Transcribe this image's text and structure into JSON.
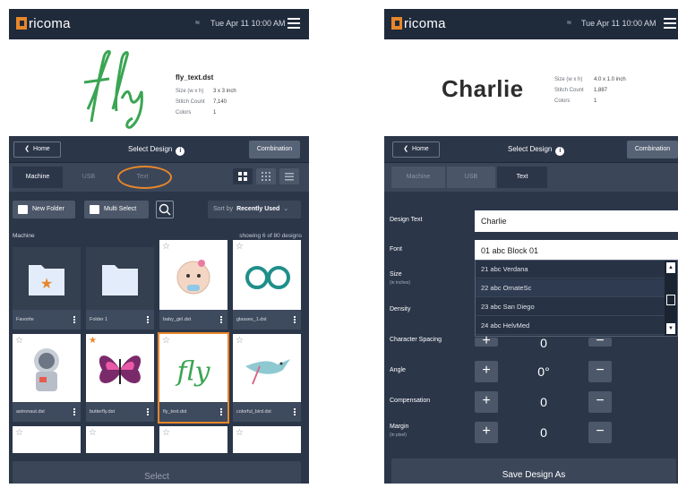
{
  "status": {
    "brand": "ricoma",
    "time": "Tue Apr 11  10:00 AM"
  },
  "left": {
    "design": {
      "art_text": "fly",
      "file": "fly_text.dst",
      "size_label": "Size (w x h)",
      "size_value": "3 x 3 inch",
      "stitch_label": "Stitch Count",
      "stitch_value": "7,140",
      "colors_label": "Colors",
      "colors_value": "1"
    },
    "nav": {
      "home": "Home",
      "title": "Select Design",
      "combination": "Combination"
    },
    "tabs": [
      "Machine",
      "USB",
      "Text"
    ],
    "actions": {
      "new_folder": "New Folder",
      "multi_select": "Multi Select",
      "sort_prefix": "Sort by",
      "sort_value": "Recently Used"
    },
    "location": "Machine",
    "showing": "showing 6 of 80 designs",
    "tiles": [
      {
        "name": "Favorite"
      },
      {
        "name": "Folder 1"
      },
      {
        "name": "baby_girl.dst"
      },
      {
        "name": "glasses_1.dst"
      },
      {
        "name": "astronaut.dst"
      },
      {
        "name": "butterfly.dst"
      },
      {
        "name": "fly_text.dst"
      },
      {
        "name": "colorful_bird.dst"
      }
    ],
    "select": "Select"
  },
  "right": {
    "design": {
      "art_text": "Charlie",
      "size_label": "Size (w x h)",
      "size_value": "4.0 x 1.0 inch",
      "stitch_label": "Stitch Count",
      "stitch_value": "1,887",
      "colors_label": "Colors",
      "colors_value": "1"
    },
    "nav": {
      "home": "Home",
      "title": "Select Design",
      "combination": "Combination"
    },
    "tabs": [
      "Machine",
      "USB",
      "Text"
    ],
    "rows": {
      "design_text_label": "Design Text",
      "design_text_value": "Charlie",
      "font_label": "Font",
      "font_value": "01 abc Block 01",
      "size_label": "Size",
      "size_unit": "(in inches)",
      "density_label": "Density",
      "char_spacing_label": "Character Spacing",
      "char_spacing_value": "0",
      "angle_label": "Angle",
      "angle_value": "0°",
      "compensation_label": "Compensation",
      "compensation_value": "0",
      "margin_label": "Margin",
      "margin_unit": "(in pixel)",
      "margin_value": "0"
    },
    "font_options": [
      "21  abc  Verdana",
      "22  abc  OrnateSc",
      "23  abc  San Diego",
      "24  abc  HelvMed"
    ],
    "save": "Save Design As"
  },
  "colors": {
    "accent": "#e8862a",
    "header": "#1f2a3b",
    "panel": "#2b3649"
  }
}
